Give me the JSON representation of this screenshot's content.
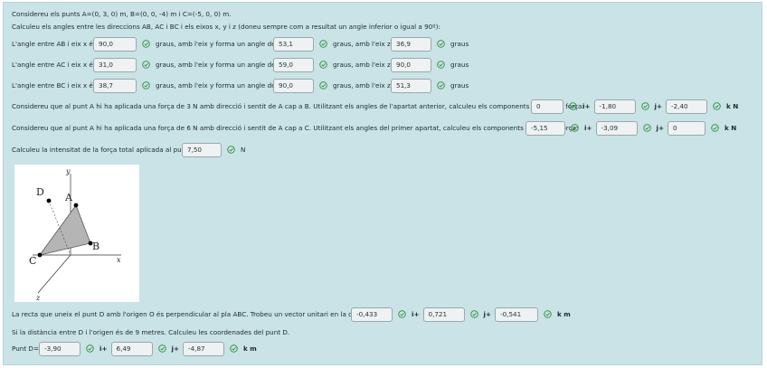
{
  "statement": "Considereu els punts A=(0, 3, 0) m, B=(0, 0, -4) m i C=(-5, 0, 0) m.",
  "instruction": "Calculeu els angles entre les direccions AB, AC i BC i els eixos x, y i z (doneu sempre com a resultat un angle inferior o igual a 90º):",
  "angles": [
    {
      "label": "L'angle entre AB i eix x és",
      "x": "90,0",
      "mid1": "graus, amb l'eix y forma un angle de",
      "y": "53,1",
      "mid2": "graus, amb l'eix z,",
      "z": "36,9",
      "end": "graus"
    },
    {
      "label": "L'angle entre AC i eix x és",
      "x": "31,0",
      "mid1": "graus, amb l'eix y forma un angle de",
      "y": "59,0",
      "mid2": "graus, amb l'eix z,",
      "z": "90,0",
      "end": "graus"
    },
    {
      "label": "L'angle entre BC i eix x és",
      "x": "38,7",
      "mid1": "graus, amb l'eix y forma un angle de",
      "y": "90,0",
      "mid2": "graus, amb l'eix z,",
      "z": "51,3",
      "end": "graus"
    }
  ],
  "force1": {
    "text": "Considereu que al punt A hi ha aplicada una força de 3 N amb direcció i sentit de A cap a B. Utilitzant els angles de l'apartat anterior, calculeu els components d'aquesta força:",
    "i": "0",
    "i_label": "i+",
    "j": "-1,80",
    "j_label": "j+",
    "k": "-2,40",
    "k_label": "k N"
  },
  "force2": {
    "text": "Considereu que al punt A hi ha aplicada una força de 6 N amb direcció i sentit de A cap a C. Utilitzant els angles del primer apartat, calculeu els components d'aquesta força:",
    "i": "-5,15",
    "i_label": "i+",
    "j": "-3,09",
    "j_label": "j+",
    "k": "0",
    "k_label": "k N"
  },
  "total": {
    "text": "Calculeu la intensitat de la força total aplicada al punt A:",
    "value": "7,50",
    "unit": "N"
  },
  "figure": {
    "labels": {
      "A": "A",
      "B": "B",
      "C": "C",
      "D": "D"
    },
    "axes": {
      "x": "x",
      "y": "y",
      "z": "z"
    }
  },
  "unit_vector": {
    "text": "La recta que uneix el punt D amb l'origen O és perpendicular al pla ABC. Trobeu un vector unitari en la direcció OD:",
    "i": "-0,433",
    "i_label": "i+",
    "j": "0,721",
    "j_label": "j+",
    "k": "-0,541",
    "k_label": "k m"
  },
  "distance_text": "Si la distància entre D i l'origen és de 9 metres. Calculeu les coordenades del punt D.",
  "point_d": {
    "label": "Punt D=",
    "i": "-3,90",
    "i_label": "i+",
    "j": "6,49",
    "j_label": "j+",
    "k": "-4,87",
    "k_label": "k m"
  },
  "colors": {
    "panel": "#c9e3e6",
    "check": "#2f8f3a",
    "field_bg": "#eef2f3"
  }
}
